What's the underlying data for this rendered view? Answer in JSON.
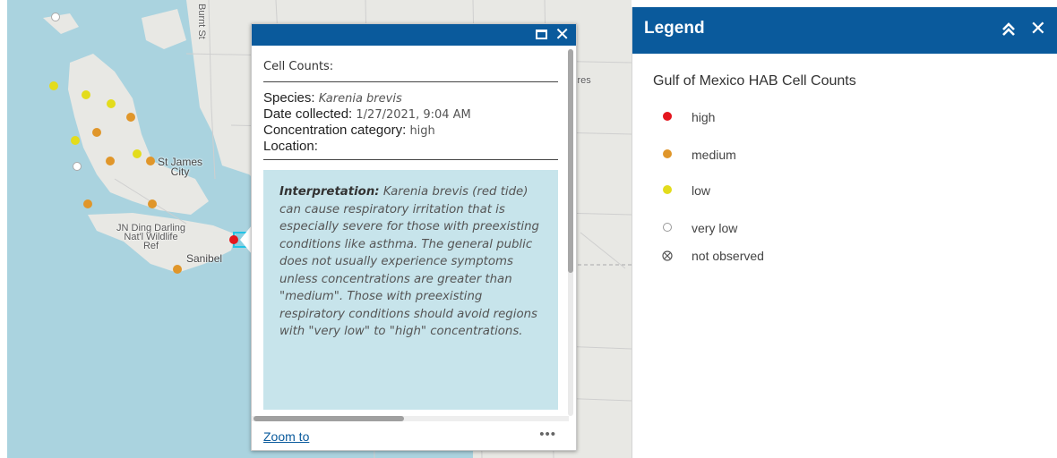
{
  "map": {
    "labels": {
      "burnt_store": "Burnt St",
      "st_james_city": [
        "St James",
        "City"
      ],
      "jn_ding_darling": [
        "JN Ding Darling",
        "Nat'l Wildlife",
        "Ref"
      ],
      "sanibel": "Sanibel",
      "cres": "cres"
    },
    "colors": {
      "water": "#aad3df",
      "land": "#e8e8e4",
      "selection": "#22c3e6"
    }
  },
  "popup": {
    "title": "Cell Counts:",
    "species_label": "Species:",
    "species_value": "Karenia brevis",
    "date_label": "Date collected:",
    "date_value": "1/27/2021, 9:04 AM",
    "concentration_label": "Concentration category:",
    "concentration_value": "high",
    "location_label": "Location:",
    "interpretation_label": "Interpretation:",
    "interpretation_text": "Karenia brevis (red tide) can cause respiratory irritation that is especially severe for those with preexisting conditions like asthma. The general public does not usually experience symptoms unless concentrations are greater than \"medium\". Those with preexisting respiratory conditions should avoid regions with \"very low\" to \"high\" concentrations.",
    "zoom_to": "Zoom to",
    "more": "•••",
    "close": "✕",
    "accent": "#0a5a9c"
  },
  "legend": {
    "title": "Legend",
    "close": "✕",
    "layer_title": "Gulf of Mexico HAB Cell Counts",
    "items": [
      {
        "label": "high",
        "color": "#e4161e"
      },
      {
        "label": "medium",
        "color": "#e0962a"
      },
      {
        "label": "low",
        "color": "#e3dc1c"
      },
      {
        "label": "very low",
        "color": "#ffffff"
      },
      {
        "label": "not observed",
        "color": "#ffffff"
      }
    ]
  }
}
